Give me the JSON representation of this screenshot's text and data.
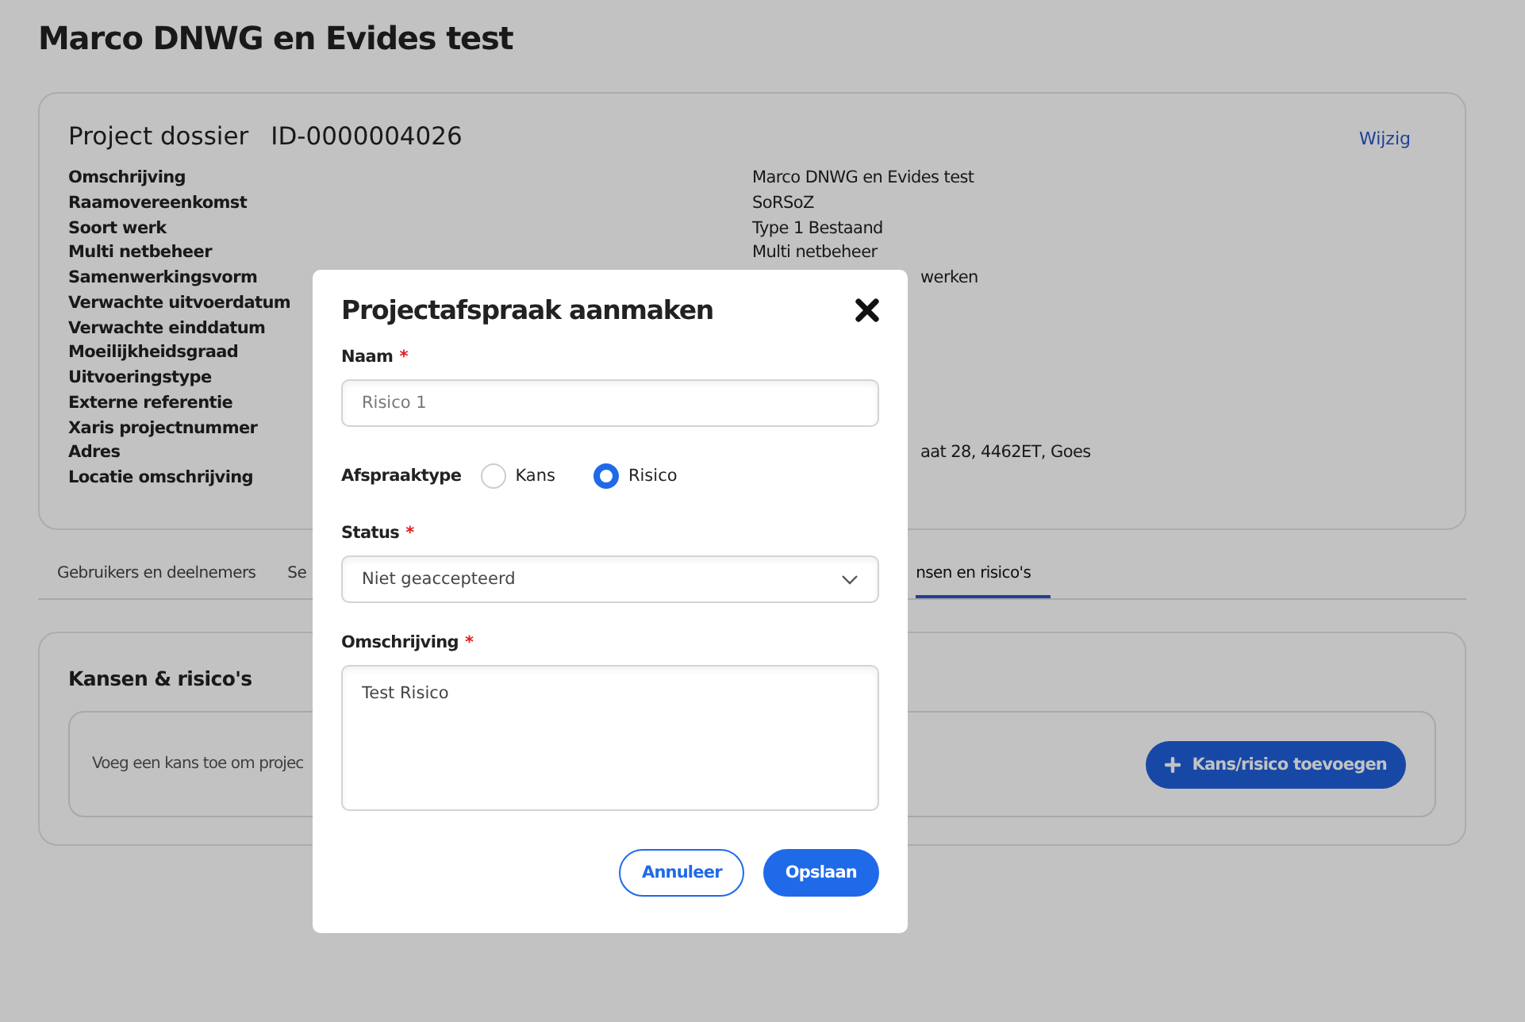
{
  "page_title": "Marco DNWG en Evides test",
  "dossier": {
    "title": "Project dossier",
    "id": "ID-0000004026",
    "edit_link": "Wijzig",
    "rows": [
      {
        "label": "Omschrijving",
        "value": "Marco DNWG en Evides test"
      },
      {
        "label": "Raamovereenkomst",
        "value": "SoRSoZ"
      },
      {
        "label": "Soort werk",
        "value": "Type 1 Bestaand"
      },
      {
        "label": "Multi netbeheer",
        "value": "Multi netbeheer"
      },
      {
        "label": "Samenwerkingsvorm",
        "value_fragment": "werken"
      },
      {
        "label": "Verwachte uitvoerdatum"
      },
      {
        "label": "Verwachte einddatum"
      },
      {
        "label": "Moeilijkheidsgraad"
      },
      {
        "label": "Uitvoeringstype"
      },
      {
        "label": "Externe referentie"
      },
      {
        "label": "Xaris projectnummer"
      },
      {
        "label": "Adres",
        "value_fragment": "aat 28, 4462ET, Goes"
      },
      {
        "label": "Locatie omschrijving"
      }
    ]
  },
  "tabs": [
    {
      "label": "Gebruikers en deelnemers",
      "selected": false
    },
    {
      "label": "Se",
      "selected": false
    },
    {
      "label": "nsen en risico's",
      "selected": true
    }
  ],
  "risks_card": {
    "title": "Kansen & risico's",
    "empty_text": "Voeg een kans toe om projec",
    "add_button": "Kans/risico toevoegen"
  },
  "modal": {
    "title": "Projectafspraak aanmaken",
    "name_label": "Naam",
    "name_required_mark": "*",
    "name_placeholder": "Risico 1",
    "type_label": "Afspraaktype",
    "type_options": [
      {
        "label": "Kans",
        "selected": false
      },
      {
        "label": "Risico",
        "selected": true
      }
    ],
    "status_label": "Status",
    "status_required_mark": "*",
    "status_value": "Niet geaccepteerd",
    "description_label": "Omschrijving",
    "description_required_mark": "*",
    "description_value": "Test Risico",
    "cancel_button": "Annuleer",
    "save_button": "Opslaan"
  }
}
